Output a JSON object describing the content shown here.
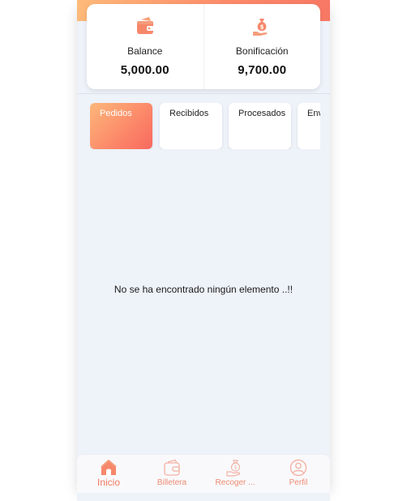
{
  "colors": {
    "accent": "#f77864",
    "accent_light": "#fdba7a",
    "background": "#eef2f9"
  },
  "summary": {
    "balance": {
      "label": "Balance",
      "value": "5,000.00",
      "icon": "wallet-icon"
    },
    "bonus": {
      "label": "Bonificación",
      "value": "9,700.00",
      "icon": "money-bag-hand-icon"
    }
  },
  "tabs": [
    {
      "label": "Pedidos",
      "active": true
    },
    {
      "label": "Recibidos",
      "active": false
    },
    {
      "label": "Procesados",
      "active": false
    },
    {
      "label": "Enviados",
      "active": false
    }
  ],
  "empty_state": {
    "message": "No se ha encontrado ningún elemento ..!!"
  },
  "bottom_nav": [
    {
      "label": "Inicio",
      "icon": "home-icon",
      "active": true
    },
    {
      "label": "Billetera",
      "icon": "wallet-icon",
      "active": false
    },
    {
      "label": "Recoger ...",
      "icon": "money-bag-hand-icon",
      "active": false
    },
    {
      "label": "Perfil",
      "icon": "user-circle-icon",
      "active": false
    }
  ]
}
